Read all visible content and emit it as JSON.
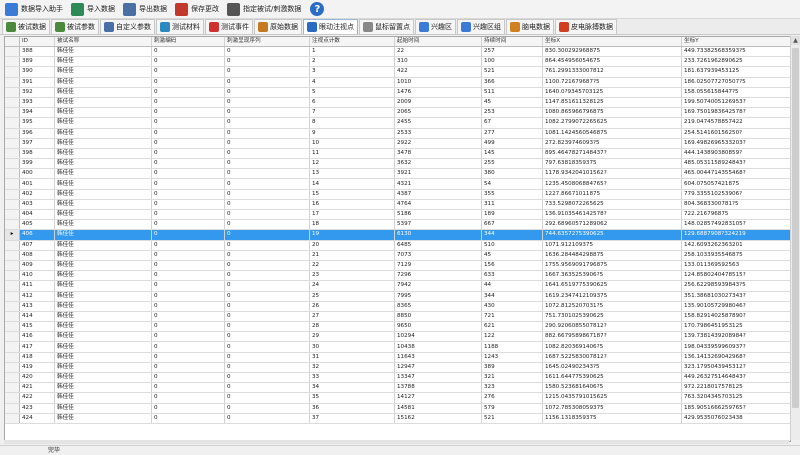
{
  "toolbar": {
    "buttons": [
      {
        "label": "数据导入助手",
        "icon": "import-wizard-icon",
        "color": "#3a7bd5"
      },
      {
        "label": "导入数据",
        "icon": "import-icon",
        "color": "#2e8b57"
      },
      {
        "label": "导出数据",
        "icon": "export-icon",
        "color": "#4a6fa5"
      },
      {
        "label": "保存更改",
        "icon": "save-icon",
        "color": "#c0392b"
      },
      {
        "label": "指定被试/刺激数据",
        "icon": "assign-icon",
        "color": "#555555"
      }
    ],
    "help_label": "?"
  },
  "tabs": [
    {
      "label": "被试数据",
      "icon": "subject-icon",
      "color": "#4a8a3a"
    },
    {
      "label": "被试参数",
      "icon": "params-icon",
      "color": "#4a8a3a"
    },
    {
      "label": "自定义参数",
      "icon": "custom-params-icon",
      "color": "#4a6fa5"
    },
    {
      "label": "测试材料",
      "icon": "material-icon",
      "color": "#2a8ac0"
    },
    {
      "label": "测试事件",
      "icon": "event-icon",
      "color": "#d03030"
    },
    {
      "label": "原始数据",
      "icon": "raw-data-icon",
      "color": "#c47a20"
    },
    {
      "label": "眼动注视点",
      "icon": "fixation-icon",
      "color": "#2a6ac0",
      "active": true
    },
    {
      "label": "鼠标留置点",
      "icon": "mouse-icon",
      "color": "#888888"
    },
    {
      "label": "兴趣区",
      "icon": "aoi-icon",
      "color": "#3a7bd5"
    },
    {
      "label": "兴趣区组",
      "icon": "aoi-group-icon",
      "color": "#3a7bd5"
    },
    {
      "label": "脑电数据",
      "icon": "eeg-icon",
      "color": "#d08020"
    },
    {
      "label": "皮电脉搏数据",
      "icon": "gsr-icon",
      "color": "#d04020"
    }
  ],
  "grid": {
    "columns": [
      "ID",
      "被试名称",
      "刺激编码",
      "刺激呈现序列",
      "注视点计数",
      "起始时间",
      "持续时间",
      "坐标X",
      "坐标Y"
    ],
    "selected_id": "406",
    "rows": [
      [
        "388",
        "韩佳佳",
        "0",
        "0",
        "1",
        "22",
        "257",
        "830.300292968875",
        "449.733825683593?5"
      ],
      [
        "389",
        "韩佳佳",
        "0",
        "0",
        "2",
        "310",
        "100",
        "864.454956054675",
        "233.7261962890625"
      ],
      [
        "390",
        "韩佳佳",
        "0",
        "0",
        "3",
        "422",
        "521",
        "761.2991333007812",
        "181.637939453125"
      ],
      [
        "391",
        "韩佳佳",
        "0",
        "0",
        "4",
        "1010",
        "366",
        "1100.721679687?5",
        "186.025077270507?5"
      ],
      [
        "392",
        "韩佳佳",
        "0",
        "0",
        "5",
        "1476",
        "511",
        "1640.0?9345703125",
        "158.0556158447?5"
      ],
      [
        "393",
        "韩佳佳",
        "0",
        "0",
        "6",
        "2009",
        "45",
        "1147.851611328125",
        "199.5074005126953?"
      ],
      [
        "394",
        "韩佳佳",
        "0",
        "0",
        "7",
        "2065",
        "253",
        "1080.865966796875",
        "169.7501983642578?"
      ],
      [
        "395",
        "韩佳佳",
        "0",
        "0",
        "8",
        "2455",
        "67",
        "1082.2799072265625",
        "219.0474578857422"
      ],
      [
        "396",
        "韩佳佳",
        "0",
        "0",
        "9",
        "2533",
        "277",
        "1081.1424560546875",
        "254.514160156250?"
      ],
      [
        "397",
        "韩佳佳",
        "0",
        "0",
        "10",
        "2922",
        "499",
        "272.8239746093?5",
        "169.4982696533203?"
      ],
      [
        "398",
        "韩佳佳",
        "0",
        "0",
        "11",
        "3478",
        "145",
        "895.4647827148437?",
        "444.143890380859?"
      ],
      [
        "399",
        "韩佳佳",
        "0",
        "0",
        "12",
        "3632",
        "255",
        "797.63818359375",
        "485.0531158924843?"
      ],
      [
        "400",
        "韩佳佳",
        "0",
        "0",
        "13",
        "3921",
        "380",
        "1178.934204101562?",
        "465.0044714355468?"
      ],
      [
        "401",
        "韩佳佳",
        "0",
        "0",
        "14",
        "4321",
        "54",
        "1235.450806884765?",
        "604.075057421875"
      ],
      [
        "402",
        "韩佳佳",
        "0",
        "0",
        "15",
        "4387",
        "355",
        "1227.86671011875",
        "779.335510253906?"
      ],
      [
        "403",
        "韩佳佳",
        "0",
        "0",
        "16",
        "4764",
        "311",
        "733.5298072265625",
        "804.3683300781?5"
      ],
      [
        "404",
        "韩佳佳",
        "0",
        "0",
        "17",
        "5186",
        "189",
        "136.9103546142578?",
        "722.216796875"
      ],
      [
        "405",
        "韩佳佳",
        "0",
        "0",
        "18",
        "5397",
        "667",
        "292.68960571289062",
        "148.0285749283105?"
      ],
      [
        "406",
        "韩佳佳",
        "0",
        "0",
        "19",
        "6130",
        "344",
        "744.6357275390625",
        "129.6887908?324219"
      ],
      [
        "407",
        "韩佳佳",
        "0",
        "0",
        "20",
        "6485",
        "510",
        "1071.912109375",
        "142.6093262363201"
      ],
      [
        "408",
        "韩佳佳",
        "0",
        "0",
        "21",
        "7073",
        "45",
        "1636.284484298875",
        "258.1033935546875"
      ],
      [
        "409",
        "韩佳佳",
        "0",
        "0",
        "22",
        "7129",
        "156",
        "1755.9569091796875",
        "133.011369592563"
      ],
      [
        "410",
        "韩佳佳",
        "0",
        "0",
        "23",
        "7296",
        "633",
        "1667.3635253906?5",
        "124.8580240478515?"
      ],
      [
        "411",
        "韩佳佳",
        "0",
        "0",
        "24",
        "7942",
        "44",
        "1641.6519775390625",
        "256.622985939843?5"
      ],
      [
        "412",
        "韩佳佳",
        "0",
        "0",
        "25",
        "7995",
        "344",
        "1619.2347412109375",
        "351.3868103027343?"
      ],
      [
        "413",
        "韩佳佳",
        "0",
        "0",
        "26",
        "8365",
        "430",
        "1072.8125207031?5",
        "135.9010572998046?"
      ],
      [
        "414",
        "韩佳佳",
        "0",
        "0",
        "27",
        "8850",
        "721",
        "751.7301025390625",
        "158.8291402587890?"
      ],
      [
        "415",
        "韩佳佳",
        "0",
        "0",
        "28",
        "9650",
        "621",
        "290.9206085507812?",
        "170.7986451953125"
      ],
      [
        "416",
        "韩佳佳",
        "0",
        "0",
        "29",
        "10294",
        "122",
        "882.6679589867187?",
        "139.7381439208984?"
      ],
      [
        "417",
        "韩佳佳",
        "0",
        "0",
        "30",
        "10438",
        "1188",
        "1082.8203691406?5",
        "198.0433959960937?"
      ],
      [
        "418",
        "韩佳佳",
        "0",
        "0",
        "31",
        "11643",
        "1243",
        "1687.522583007812?",
        "136.1413269042968?"
      ],
      [
        "419",
        "韩佳佳",
        "0",
        "0",
        "32",
        "12947",
        "389",
        "1645.024902343?5",
        "323.1795043945312?"
      ],
      [
        "420",
        "韩佳佳",
        "0",
        "0",
        "33",
        "13347",
        "321",
        "1611.644775390625",
        "449.2632751464843?"
      ],
      [
        "421",
        "韩佳佳",
        "0",
        "0",
        "34",
        "13788",
        "323",
        "1580.5236816406?5",
        "972.2218017578125"
      ],
      [
        "422",
        "韩佳佳",
        "0",
        "0",
        "35",
        "14127",
        "276",
        "1215.0435791015625",
        "763.3204345703125"
      ],
      [
        "423",
        "韩佳佳",
        "0",
        "0",
        "36",
        "14581",
        "579",
        "1072.785308059375",
        "185.9051666259765?"
      ],
      [
        "424",
        "韩佳佳",
        "0",
        "0",
        "37",
        "15162",
        "521",
        "1156.1318359375",
        "429.9535076023438"
      ]
    ]
  },
  "status": {
    "text": "完毕"
  },
  "colors": {
    "selection": "#3399ee",
    "grid_line": "#d2d2d2"
  }
}
